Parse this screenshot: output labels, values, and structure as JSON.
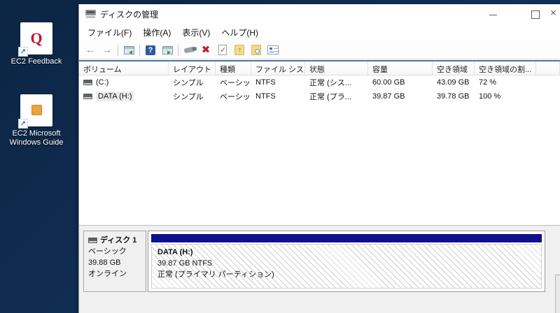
{
  "desktop": {
    "background": "#0d2b4e",
    "icons": [
      {
        "label": "EC2 Feedback",
        "glyph": "Q",
        "glyph_color": "#c8102e"
      },
      {
        "label_line1": "EC2 Microsoft",
        "label_line2": "Windows Guide"
      }
    ]
  },
  "window": {
    "title": "ディスクの管理",
    "controls": {
      "minimize": "minimize",
      "maximize": "maximize",
      "close": "close"
    },
    "menu": {
      "file": "ファイル(F)",
      "action": "操作(A)",
      "view": "表示(V)",
      "help": "ヘルプ(H)"
    },
    "toolbar": {
      "icons": [
        "back",
        "forward",
        "show-console-tree",
        "help",
        "show-action-pane",
        "tool",
        "delete",
        "mark-partition",
        "change-drive-letter",
        "explore",
        "properties"
      ]
    },
    "volume_list": {
      "columns": {
        "volume": "ボリューム",
        "layout": "レイアウト",
        "type": "種類",
        "filesystem": "ファイル システム",
        "status": "状態",
        "capacity": "容量",
        "free": "空き領域",
        "free_pct": "空き領域の割..."
      },
      "rows": [
        {
          "volume": "(C:)",
          "layout": "シンプル",
          "type": "ベーシック",
          "filesystem": "NTFS",
          "status": "正常 (シス...",
          "capacity": "60.00 GB",
          "free": "43.09 GB",
          "free_pct": "72 %"
        },
        {
          "volume": "DATA (H:)",
          "layout": "シンプル",
          "type": "ベーシック",
          "filesystem": "NTFS",
          "status": "正常 (プラ...",
          "capacity": "39.87 GB",
          "free": "39.78 GB",
          "free_pct": "100 %"
        }
      ]
    },
    "graphical_view": {
      "disk": {
        "name": "ディスク 1",
        "type": "ベーシック",
        "size": "39.88 GB",
        "status": "オンライン"
      },
      "partition": {
        "title": "DATA  (H:)",
        "size_fs": "39.87 GB NTFS",
        "status": "正常 (プライマリ パーティション)",
        "bar_color": "#10108e"
      }
    }
  }
}
